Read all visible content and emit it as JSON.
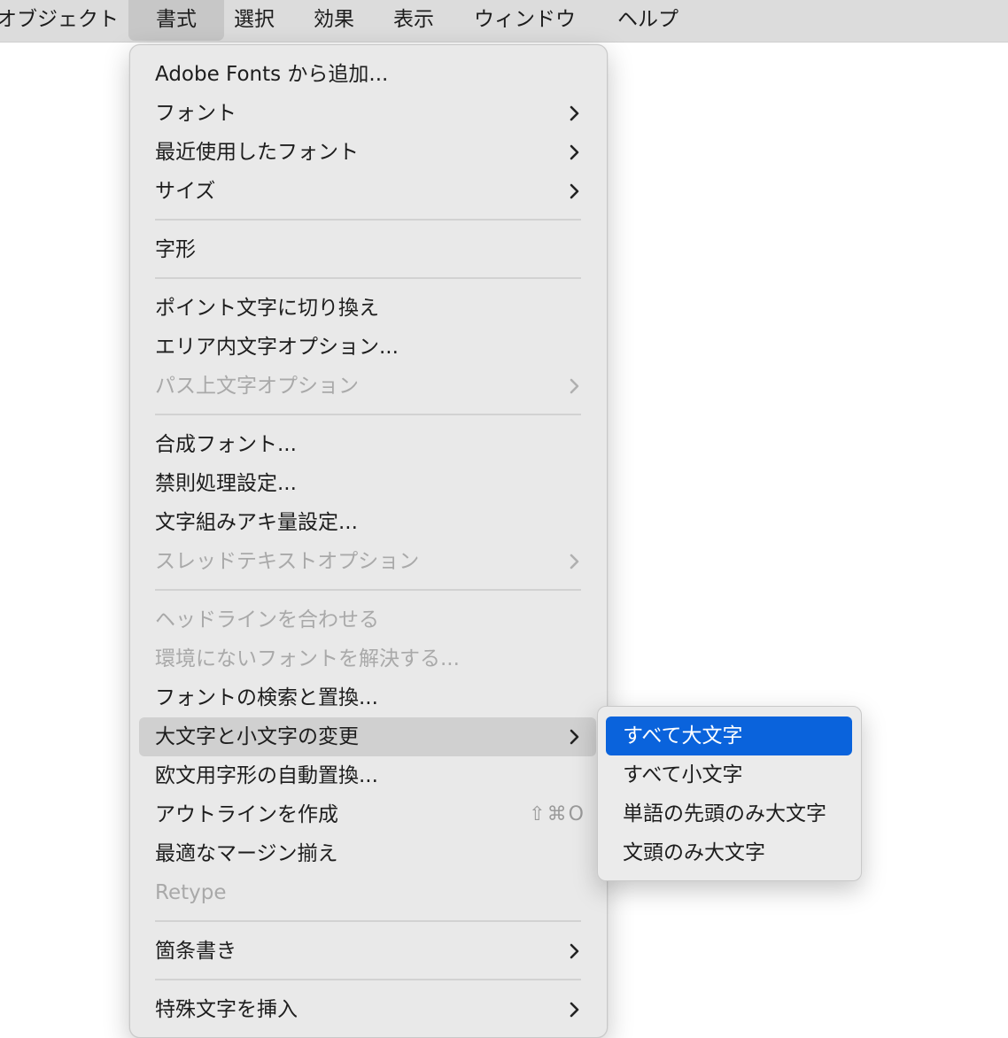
{
  "menubar": {
    "items": [
      {
        "label": "オブジェクト"
      },
      {
        "label": "書式"
      },
      {
        "label": "選択"
      },
      {
        "label": "効果"
      },
      {
        "label": "表示"
      },
      {
        "label": "ウィンドウ"
      },
      {
        "label": "ヘルプ"
      }
    ],
    "open_index": 1
  },
  "menu": {
    "items": [
      {
        "label": "Adobe Fonts から追加..."
      },
      {
        "label": "フォント",
        "submenu": true
      },
      {
        "label": "最近使用したフォント",
        "submenu": true
      },
      {
        "label": "サイズ",
        "submenu": true
      },
      {
        "label": "字形"
      },
      {
        "label": "ポイント文字に切り換え"
      },
      {
        "label": "エリア内文字オプション..."
      },
      {
        "label": "パス上文字オプション",
        "submenu": true,
        "disabled": true
      },
      {
        "label": "合成フォント..."
      },
      {
        "label": "禁則処理設定..."
      },
      {
        "label": "文字組みアキ量設定..."
      },
      {
        "label": "スレッドテキストオプション",
        "submenu": true,
        "disabled": true
      },
      {
        "label": "ヘッドラインを合わせる",
        "disabled": true
      },
      {
        "label": "環境にないフォントを解決する...",
        "disabled": true
      },
      {
        "label": "フォントの検索と置換..."
      },
      {
        "label": "大文字と小文字の変更",
        "submenu": true,
        "highlighted": true
      },
      {
        "label": "欧文用字形の自動置換..."
      },
      {
        "label": "アウトラインを作成",
        "shortcut": "⇧⌘O"
      },
      {
        "label": "最適なマージン揃え"
      },
      {
        "label": "Retype",
        "disabled": true
      },
      {
        "label": "箇条書き",
        "submenu": true
      },
      {
        "label": "特殊文字を挿入",
        "submenu": true
      }
    ]
  },
  "submenu": {
    "items": [
      {
        "label": "すべて大文字",
        "selected": true
      },
      {
        "label": "すべて小文字"
      },
      {
        "label": "単語の先頭のみ大文字"
      },
      {
        "label": "文頭のみ大文字"
      }
    ]
  },
  "colors": {
    "selection_blue": "#0a63dc",
    "menu_background": "#e9e9e9",
    "menubar_background": "#dcdcdc",
    "disabled_text": "#a9a9a9"
  }
}
